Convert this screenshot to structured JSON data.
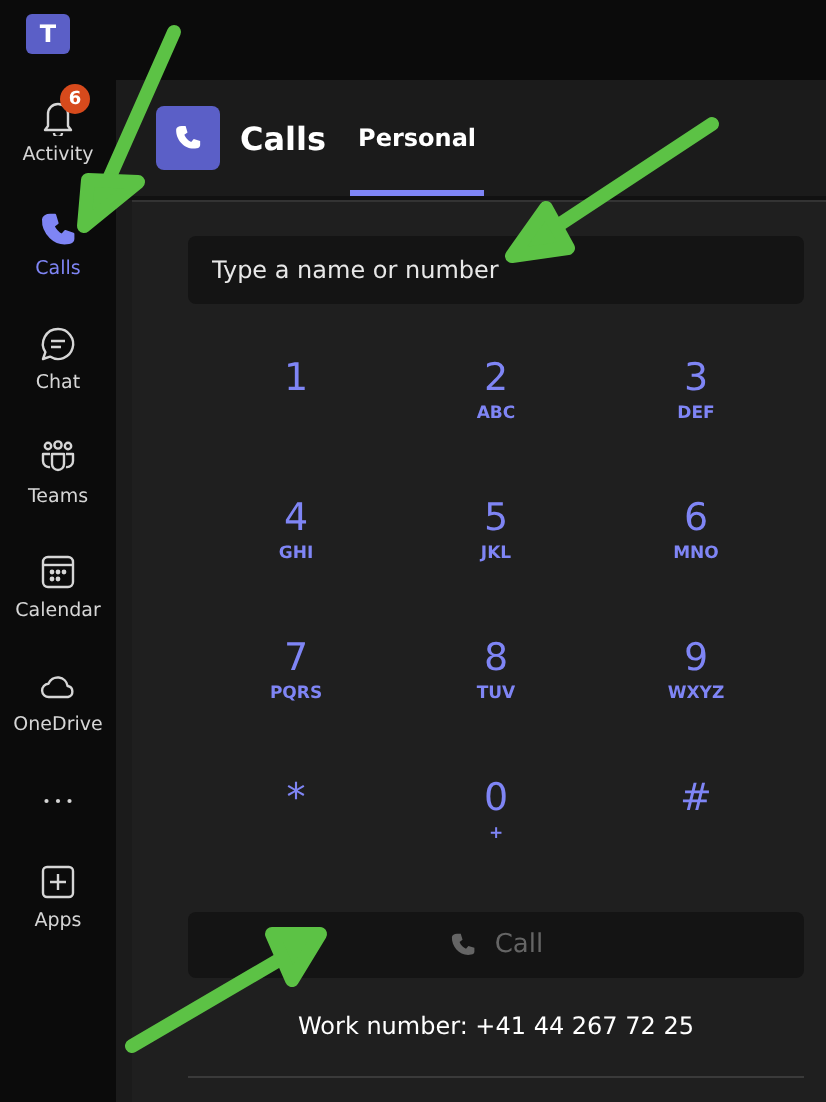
{
  "app": {
    "logo_letter": "T"
  },
  "rail": {
    "items": [
      {
        "kind": "bell",
        "label": "Activity",
        "selected": false,
        "badge": "6"
      },
      {
        "kind": "phone",
        "label": "Calls",
        "selected": true
      },
      {
        "kind": "chat",
        "label": "Chat",
        "selected": false
      },
      {
        "kind": "teams",
        "label": "Teams",
        "selected": false
      },
      {
        "kind": "calendar",
        "label": "Calendar",
        "selected": false
      },
      {
        "kind": "cloud",
        "label": "OneDrive",
        "selected": false
      },
      {
        "kind": "more",
        "selected": false
      },
      {
        "kind": "apps",
        "label": "Apps",
        "selected": false
      }
    ]
  },
  "header": {
    "title": "Calls",
    "tabs": [
      {
        "label": "Personal",
        "selected": true
      }
    ]
  },
  "dialer": {
    "search": {
      "placeholder": "Type a name or number"
    },
    "keys": [
      {
        "digit": "1"
      },
      {
        "digit": "2",
        "letters": "ABC"
      },
      {
        "digit": "3",
        "letters": "DEF"
      },
      {
        "digit": "4",
        "letters": "GHI"
      },
      {
        "digit": "5",
        "letters": "JKL"
      },
      {
        "digit": "6",
        "letters": "MNO"
      },
      {
        "digit": "7",
        "letters": "PQRS"
      },
      {
        "digit": "8",
        "letters": "TUV"
      },
      {
        "digit": "9",
        "letters": "WXYZ"
      },
      {
        "digit": "*"
      },
      {
        "digit": "0",
        "letters": "+"
      },
      {
        "digit": "#"
      }
    ],
    "call_button": {
      "label": "Call",
      "disabled": true
    },
    "work_number": "Work number: +41 44 267 72 25"
  }
}
